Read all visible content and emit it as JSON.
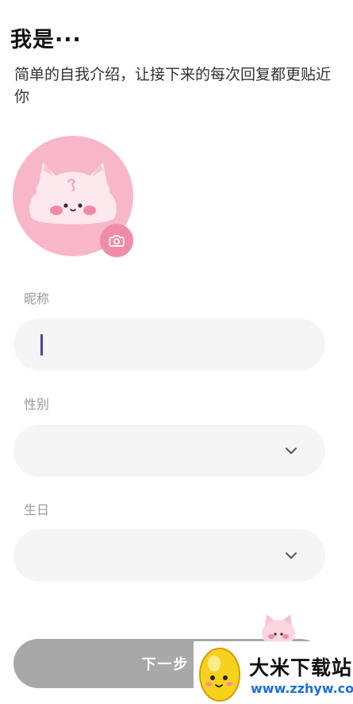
{
  "header": {
    "title": "我是···",
    "subtitle": "简单的自我介绍，让接下来的每次回复都更贴近你"
  },
  "avatar": {
    "icon": "cat-avatar-icon",
    "background_color": "#f7b7c9",
    "camera_icon": "camera-icon"
  },
  "form": {
    "nickname": {
      "label": "昵称",
      "value": "",
      "placeholder": ""
    },
    "gender": {
      "label": "性别",
      "value": ""
    },
    "birthday": {
      "label": "生日",
      "value": ""
    }
  },
  "actions": {
    "next_label": "下一步"
  },
  "watermark": {
    "title": "大米下载站",
    "url": "www.zzhyw.com"
  },
  "colors": {
    "accent": "#f08da6",
    "button_disabled": "#a8a8a8",
    "caret": "#4b3f9c",
    "field_bg": "#f5f5f5"
  }
}
